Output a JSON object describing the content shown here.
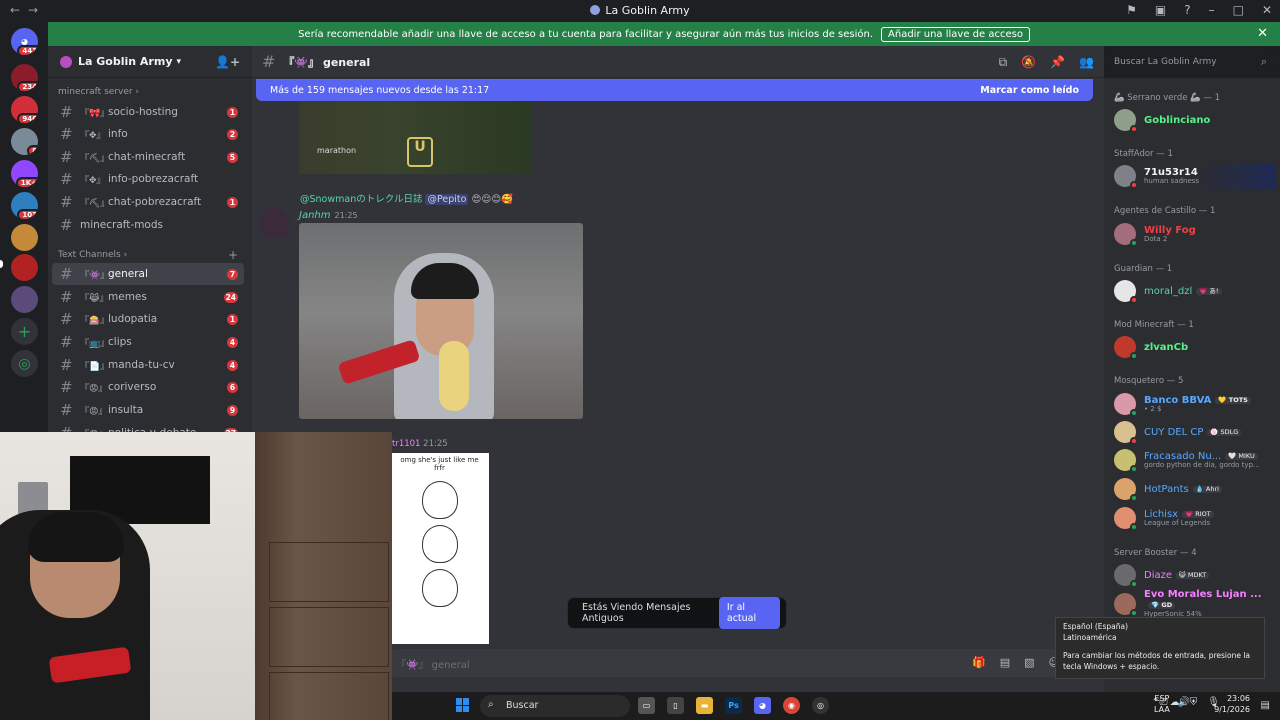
{
  "window": {
    "title": "La Goblin Army"
  },
  "banner": {
    "text": "Sería recomendable añadir una llave de acceso a tu cuenta para facilitar y asegurar aún más tus inicios de sesión.",
    "button": "Añadir una llave de acceso"
  },
  "guilds": [
    {
      "badge": "443"
    },
    {
      "badge": "234"
    },
    {
      "badge": "946"
    },
    {
      "badge": "8"
    },
    {
      "badge": "1K+"
    },
    {
      "badge": "103"
    },
    {
      "badge": ""
    },
    {
      "badge": ""
    }
  ],
  "server": {
    "name": "La Goblin Army"
  },
  "categories": {
    "minecraft": "minecraft server",
    "text": "Text Channels"
  },
  "channels": [
    {
      "emoji": "『🎀』",
      "name": "socio-hosting",
      "count": "1"
    },
    {
      "emoji": "『✥』",
      "name": "info",
      "count": "2"
    },
    {
      "emoji": "『⛏』",
      "name": "chat-minecraft",
      "count": "5"
    },
    {
      "emoji": "『✥』",
      "name": "info-pobrezacraft",
      "count": ""
    },
    {
      "emoji": "『⛏』",
      "name": "chat-pobrezacraft",
      "count": "1"
    },
    {
      "emoji": "",
      "name": "minecraft-mods",
      "count": ""
    },
    {
      "emoji": "『👾』",
      "name": "general",
      "count": "7"
    },
    {
      "emoji": "『😹』",
      "name": "memes",
      "count": "24"
    },
    {
      "emoji": "『🎰』",
      "name": "ludopatia",
      "count": "1"
    },
    {
      "emoji": "『📺』",
      "name": "clips",
      "count": "4"
    },
    {
      "emoji": "『📄』",
      "name": "manda-tu-cv",
      "count": "4"
    },
    {
      "emoji": "『😡』",
      "name": "coriverso",
      "count": "6"
    },
    {
      "emoji": "『😡』",
      "name": "insulta",
      "count": "9"
    },
    {
      "emoji": "『😡』",
      "name": "politica-y-debate",
      "count": "27"
    }
  ],
  "topbar": {
    "emoji": "『👾』",
    "channel": "general"
  },
  "newMessages": {
    "text": "Más de 159 mensajes nuevos desde las 21:17",
    "mark": "Marcar como leído"
  },
  "messages": {
    "reply_user": "@Snowmanのトレクル日誌",
    "reply_mention": "@Pepito",
    "reply_emojis": "😍😌😊🥰",
    "author": "Janhm",
    "time1": "21:25",
    "author2": "tr1101",
    "time2": "21:25",
    "meme_caption": "omg she's just like me frfr",
    "meme_brand": "marathon"
  },
  "toast": {
    "text": "Estás Viendo Mensajes Antiguos",
    "button": "Ir al actual"
  },
  "composer": {
    "placeholder": "『👾』 general"
  },
  "search": {
    "placeholder": "Buscar La Goblin Army"
  },
  "roles": [
    {
      "label": "🦾 Serrano verde 🦾 — 1"
    },
    {
      "label": "StaffAdor — 1"
    },
    {
      "label": "Agentes de Castillo — 1"
    },
    {
      "label": "Guardian — 1"
    },
    {
      "label": "Mod Minecraft — 1"
    },
    {
      "label": "Mosquetero — 5"
    },
    {
      "label": "Server Booster — 4"
    }
  ],
  "members": [
    {
      "name": "Goblinciano",
      "sub": "",
      "tag": "",
      "color": "#57f287"
    },
    {
      "name": "71u53r14",
      "sub": "human sadness",
      "tag": "",
      "color": "#f2f3f5"
    },
    {
      "name": "Willy Fog",
      "sub": "Dota 2",
      "tag": "",
      "color": "#ed4245"
    },
    {
      "name": "moral_dzl",
      "sub": "",
      "tag": "💗 あ!",
      "color": "#57d6a6"
    },
    {
      "name": "zlvanCb",
      "sub": "",
      "tag": "",
      "color": "#57f287"
    },
    {
      "name": "Banco BBVA",
      "sub": "• 2 $",
      "tag": "💛 TOTS",
      "color": "#5aa7ff"
    },
    {
      "name": "CUY DEL CP",
      "sub": "",
      "tag": "🍥 SDLG",
      "color": "#5aa7ff"
    },
    {
      "name": "Fracasado Nu...",
      "sub": "gordo python de dia, gordo typ...",
      "tag": "🤍 MIKU",
      "color": "#5aa7ff"
    },
    {
      "name": "HotPants",
      "sub": "",
      "tag": "💧 Ahri",
      "color": "#5aa7ff"
    },
    {
      "name": "Lichisx",
      "sub": "League of Legends",
      "tag": "💗 RIOT",
      "color": "#5aa7ff"
    },
    {
      "name": "Diaze",
      "sub": "",
      "tag": "😺 MDKT",
      "color": "#f47fff"
    },
    {
      "name": "Evo Morales Lujan ...",
      "sub": "HyperSonic 54%",
      "tag": "💎 GD",
      "color": "#f47fff"
    }
  ],
  "taskbar": {
    "search": "Buscar",
    "lang1": "ESP",
    "lang2": "LAA",
    "time": "23:06",
    "date": "9/1/2026"
  },
  "ime": {
    "line1": "Español (España)",
    "line2": "Latinoamérica",
    "line3": "Para cambiar los métodos de entrada, presione la tecla Windows + espacio."
  },
  "colors": {
    "accent": "#5865f2",
    "banner": "#248046",
    "unread": "#da373c"
  }
}
